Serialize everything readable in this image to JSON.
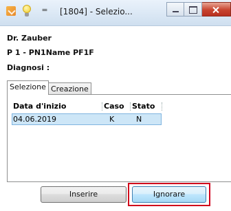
{
  "window": {
    "title": "[1804] - Selezio...",
    "quick_access_glyph": "="
  },
  "patient": {
    "doctor": "Dr. Zauber",
    "identifier": "P 1 - PN1Name PF1F",
    "diagnosis_label": "Diagnosi :"
  },
  "tabs": [
    {
      "label": "Selezione",
      "active": true
    },
    {
      "label": "Creazione",
      "active": false
    }
  ],
  "grid": {
    "columns": [
      "Data d'inizio",
      "Caso",
      "Stato"
    ],
    "rows": [
      {
        "data_inizio": "04.06.2019",
        "caso": "K",
        "stato": "N",
        "selected": true
      }
    ]
  },
  "buttons": {
    "inserire": "Inserire",
    "ignorare": "Ignorare"
  },
  "colors": {
    "highlight_border": "#d0021b",
    "selected_row": "#cde6f7",
    "close_button": "#c8442f"
  },
  "icons": [
    "app-icon",
    "lightbulb-icon",
    "quick-access-icon",
    "minimize-icon",
    "maximize-icon",
    "close-icon"
  ]
}
